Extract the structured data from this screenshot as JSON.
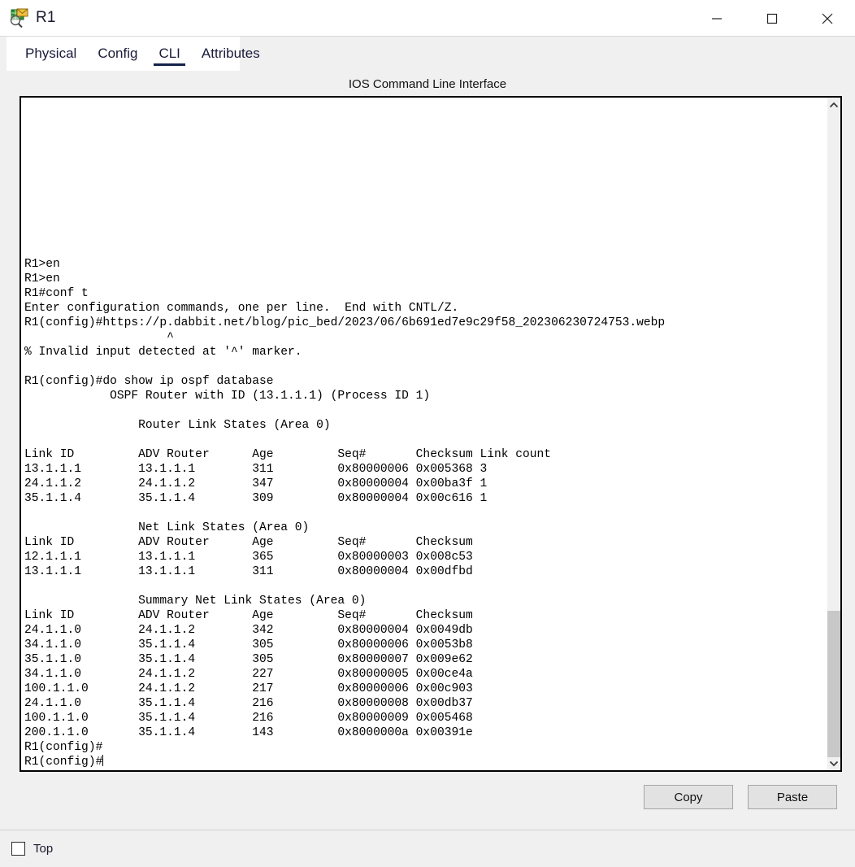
{
  "window": {
    "title": "R1",
    "icon": "router-cli-icon",
    "controls": {
      "minimize": "minimize-icon",
      "maximize": "maximize-icon",
      "close": "close-icon"
    }
  },
  "tabs": [
    {
      "label": "Physical",
      "active": false
    },
    {
      "label": "Config",
      "active": false
    },
    {
      "label": "CLI",
      "active": true
    },
    {
      "label": "Attributes",
      "active": false
    }
  ],
  "cli": {
    "header": "IOS Command Line Interface",
    "cursor": "text-caret",
    "output": "R1>en\nR1>en\nR1#conf t\nEnter configuration commands, one per line.  End with CNTL/Z.\nR1(config)#https://p.dabbit.net/blog/pic_bed/2023/06/6b691ed7e9c29f58_202306230724753.webp\n                    ^\n% Invalid input detected at '^' marker.\n\nR1(config)#do show ip ospf database\n            OSPF Router with ID (13.1.1.1) (Process ID 1)\n\n                Router Link States (Area 0)\n\nLink ID         ADV Router      Age         Seq#       Checksum Link count\n13.1.1.1        13.1.1.1        311         0x80000006 0x005368 3\n24.1.1.2        24.1.1.2        347         0x80000004 0x00ba3f 1\n35.1.1.4        35.1.1.4        309         0x80000004 0x00c616 1\n\n                Net Link States (Area 0)\nLink ID         ADV Router      Age         Seq#       Checksum\n12.1.1.1        13.1.1.1        365         0x80000003 0x008c53\n13.1.1.1        13.1.1.1        311         0x80000004 0x00dfbd\n\n                Summary Net Link States (Area 0)\nLink ID         ADV Router      Age         Seq#       Checksum\n24.1.1.0        24.1.1.2        342         0x80000004 0x0049db\n34.1.1.0        35.1.1.4        305         0x80000006 0x0053b8\n35.1.1.0        35.1.1.4        305         0x80000007 0x009e62\n34.1.1.0        24.1.1.2        227         0x80000005 0x00ce4a\n100.1.1.0       24.1.1.2        217         0x80000006 0x00c903\n24.1.1.0        35.1.1.4        216         0x80000008 0x00db37\n100.1.1.0       35.1.1.4        216         0x80000009 0x005468\n200.1.1.0       35.1.1.4        143         0x8000000a 0x00391e\nR1(config)#\nR1(config)#"
  },
  "ospf": {
    "router_id": "13.1.1.1",
    "process_id": "1",
    "sections": [
      {
        "name": "Router Link States (Area 0)",
        "columns": [
          "Link ID",
          "ADV Router",
          "Age",
          "Seq#",
          "Checksum",
          "Link count"
        ],
        "rows": [
          [
            "13.1.1.1",
            "13.1.1.1",
            "311",
            "0x80000006",
            "0x005368",
            "3"
          ],
          [
            "24.1.1.2",
            "24.1.1.2",
            "347",
            "0x80000004",
            "0x00ba3f",
            "1"
          ],
          [
            "35.1.1.4",
            "35.1.1.4",
            "309",
            "0x80000004",
            "0x00c616",
            "1"
          ]
        ]
      },
      {
        "name": "Net Link States (Area 0)",
        "columns": [
          "Link ID",
          "ADV Router",
          "Age",
          "Seq#",
          "Checksum"
        ],
        "rows": [
          [
            "12.1.1.1",
            "13.1.1.1",
            "365",
            "0x80000003",
            "0x008c53"
          ],
          [
            "13.1.1.1",
            "13.1.1.1",
            "311",
            "0x80000004",
            "0x00dfbd"
          ]
        ]
      },
      {
        "name": "Summary Net Link States (Area 0)",
        "columns": [
          "Link ID",
          "ADV Router",
          "Age",
          "Seq#",
          "Checksum"
        ],
        "rows": [
          [
            "24.1.1.0",
            "24.1.1.2",
            "342",
            "0x80000004",
            "0x0049db"
          ],
          [
            "34.1.1.0",
            "35.1.1.4",
            "305",
            "0x80000006",
            "0x0053b8"
          ],
          [
            "35.1.1.0",
            "35.1.1.4",
            "305",
            "0x80000007",
            "0x009e62"
          ],
          [
            "34.1.1.0",
            "24.1.1.2",
            "227",
            "0x80000005",
            "0x00ce4a"
          ],
          [
            "100.1.1.0",
            "24.1.1.2",
            "217",
            "0x80000006",
            "0x00c903"
          ],
          [
            "24.1.1.0",
            "35.1.1.4",
            "216",
            "0x80000008",
            "0x00db37"
          ],
          [
            "100.1.1.0",
            "35.1.1.4",
            "216",
            "0x80000009",
            "0x005468"
          ],
          [
            "200.1.1.0",
            "35.1.1.4",
            "143",
            "0x8000000a",
            "0x00391e"
          ]
        ]
      }
    ]
  },
  "scrollbar": {
    "up_icon": "chevron-up-icon",
    "down_icon": "chevron-down-icon",
    "thumb_top_percent": 77.5,
    "thumb_height_percent": 22.8
  },
  "footer": {
    "copy_label": "Copy",
    "paste_label": "Paste"
  },
  "bottom": {
    "top_label": "Top",
    "top_checked": false
  },
  "colors": {
    "accent": "#14224a",
    "window_bg": "#f0f0f0",
    "terminal_bg": "#ffffff",
    "text": "#000000",
    "scroll_thumb": "#c8c8c8"
  }
}
